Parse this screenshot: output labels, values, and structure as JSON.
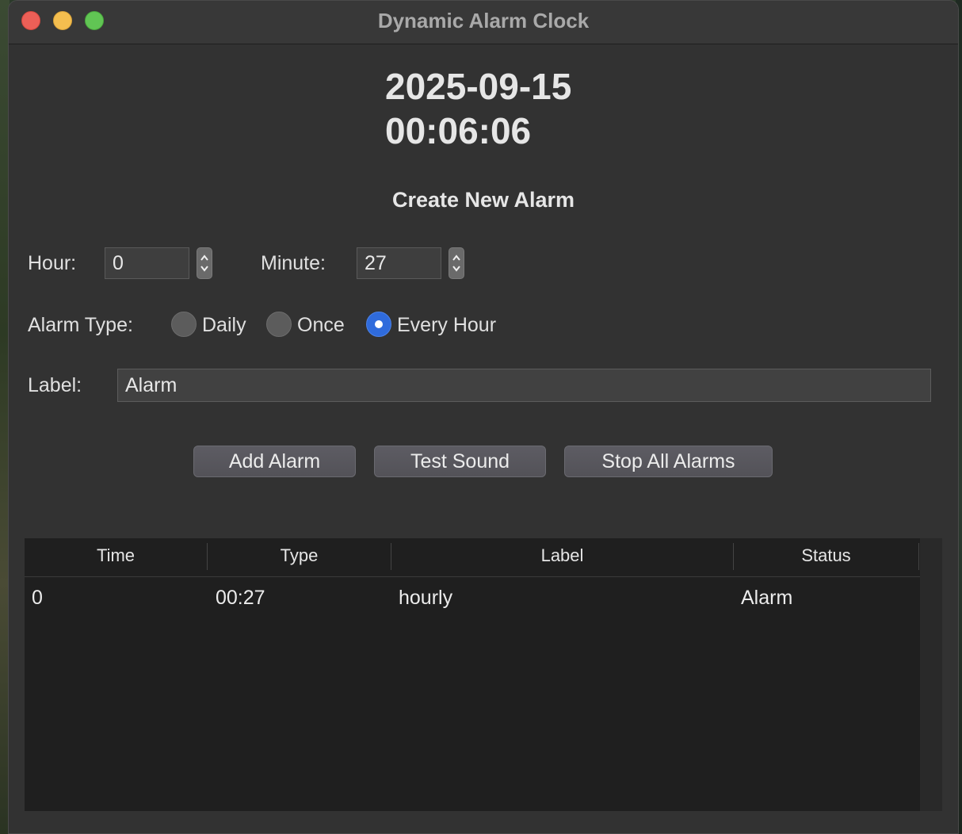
{
  "window": {
    "title": "Dynamic Alarm Clock"
  },
  "clock": {
    "date": "2025-09-15",
    "time": "00:06:06"
  },
  "form": {
    "heading": "Create New Alarm",
    "hour_label": "Hour:",
    "hour_value": "0",
    "minute_label": "Minute:",
    "minute_value": "27",
    "type_label": "Alarm Type:",
    "type_options": [
      {
        "label": "Daily",
        "selected": false
      },
      {
        "label": "Once",
        "selected": false
      },
      {
        "label": "Every Hour",
        "selected": true
      }
    ],
    "label_label": "Label:",
    "label_value": "Alarm"
  },
  "buttons": {
    "add": "Add Alarm",
    "test": "Test Sound",
    "stop": "Stop All Alarms"
  },
  "table": {
    "columns": [
      "Time",
      "Type",
      "Label",
      "Status"
    ],
    "rows": [
      [
        "0",
        "00:27",
        "hourly",
        "Alarm"
      ]
    ]
  },
  "colors": {
    "radio_selected": "#2f6bdc",
    "window_bg": "#323232",
    "table_bg": "#1f1f1f"
  },
  "icons": {
    "spinner": "chevron-up-down-icon",
    "radio_dot": "radio-dot-icon"
  }
}
